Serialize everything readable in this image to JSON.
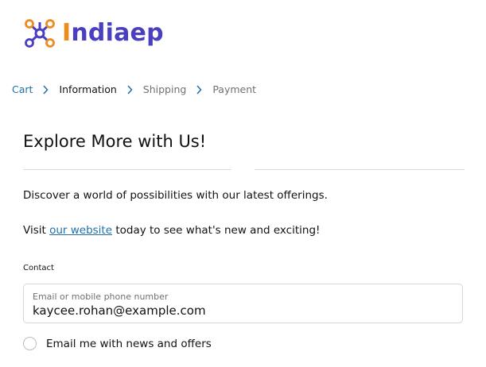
{
  "brand": {
    "name_first": "I",
    "name_rest": "ndiaep"
  },
  "breadcrumb": {
    "items": [
      {
        "label": "Cart",
        "state": "link"
      },
      {
        "label": "Information",
        "state": "current"
      },
      {
        "label": "Shipping",
        "state": "upcoming"
      },
      {
        "label": "Payment",
        "state": "upcoming"
      }
    ]
  },
  "main": {
    "heading": "Explore More with Us!",
    "paragraph1": "Discover a world of possibilities with our latest offerings.",
    "paragraph2_prefix": "Visit ",
    "paragraph2_link": "our website",
    "paragraph2_suffix": " today to see what's new and exciting!"
  },
  "contact": {
    "label": "Contact",
    "email_placeholder": "Email or mobile phone number",
    "email_value": "kaycee.rohan@example.com",
    "newsletter_label": "Email me with news and offers",
    "newsletter_checked": false
  },
  "colors": {
    "brand_purple": "#4a3fbf",
    "brand_orange": "#f08a1c",
    "link_blue": "#1f6fa8"
  }
}
